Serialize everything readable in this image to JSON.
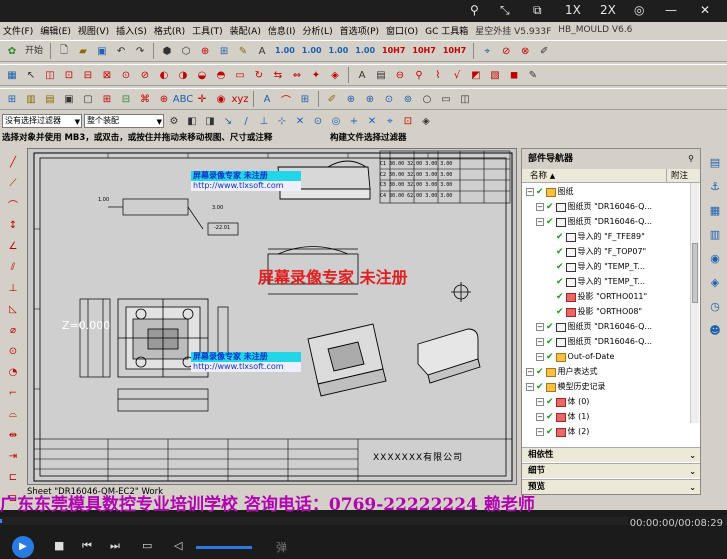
{
  "player": {
    "top_icons": [
      "pin-icon",
      "shrink-icon",
      "popout-icon"
    ],
    "speed_1x": "1X",
    "speed_2x": "2X",
    "time": "00:00:00/00:08:29",
    "danmu": "弹"
  },
  "menu": {
    "items": [
      "文件(F)",
      "编辑(E)",
      "视图(V)",
      "插入(S)",
      "格式(R)",
      "工具(T)",
      "装配(A)",
      "信息(I)",
      "分析(L)",
      "首选项(P)",
      "窗口(O)",
      "GC 工具箱",
      "星空外挂 V5.933F",
      "HB_MOULD V6.6"
    ]
  },
  "toolbar": {
    "start_label": "开始",
    "row1_text": [
      "1.00",
      "1.00",
      "1.00",
      "1.00",
      "10H7",
      "10H7",
      "10H7"
    ],
    "selection_filter": "没有选择过滤器",
    "assembly_scope": "整个装配"
  },
  "status": {
    "prompt": "选择对象并使用 MB3，或双击，或按住并拖动来移动视图、尺寸或注释",
    "secondary": "构建文件选择过滤器"
  },
  "drawing": {
    "watermark_top": "屏幕录像专家     未注册",
    "watermark_url": "http://www.tlxsoft.com",
    "watermark_big": "屏幕录像专家  未注册",
    "z_label": "Z=0.000",
    "company": "XXXXXXX有限公司",
    "sheet_label": "Sheet \"DR16046-QM-EC2\" Work",
    "table_rows": [
      [
        "C1",
        "30.00",
        "32.00",
        "3.00",
        "3.00"
      ],
      [
        "C2",
        "30.00",
        "32.00",
        "3.00",
        "3.00"
      ],
      [
        "C3",
        "30.00",
        "32.00",
        "3.00",
        "3.00"
      ],
      [
        "C4",
        "30.00",
        "62.00",
        "3.00",
        "3.00"
      ]
    ]
  },
  "navigator": {
    "title": "部件导航器",
    "col_name": "名称",
    "col_note": "附注",
    "items": [
      {
        "label": "图纸",
        "indent": 0,
        "icon": "folder"
      },
      {
        "label": "图纸页 \"DR16046-Q...",
        "indent": 1,
        "icon": "sheet"
      },
      {
        "label": "图纸页 \"DR16046-Q...",
        "indent": 1,
        "icon": "sheet"
      },
      {
        "label": "导入的 \"F_TFE89\"",
        "indent": 2,
        "icon": "view"
      },
      {
        "label": "导入的 \"F_TOP07\"",
        "indent": 2,
        "icon": "view"
      },
      {
        "label": "导入的 \"TEMP_T...",
        "indent": 2,
        "icon": "view"
      },
      {
        "label": "导入的 \"TEMP_T...",
        "indent": 2,
        "icon": "view"
      },
      {
        "label": "投影 \"ORTHO011\"",
        "indent": 2,
        "icon": "proj"
      },
      {
        "label": "投影 \"ORTHO08\"",
        "indent": 2,
        "icon": "proj"
      },
      {
        "label": "图纸页 \"DR16046-Q...",
        "indent": 1,
        "icon": "sheet"
      },
      {
        "label": "图纸页 \"DR16046-Q...",
        "indent": 1,
        "icon": "sheet"
      },
      {
        "label": "Out-of-Date",
        "indent": 1,
        "icon": "warn"
      },
      {
        "label": "用户表达式",
        "indent": 0,
        "icon": "folder"
      },
      {
        "label": "模型历史记录",
        "indent": 0,
        "icon": "folder"
      },
      {
        "label": "体 (0)",
        "indent": 1,
        "icon": "body"
      },
      {
        "label": "体 (1)",
        "indent": 1,
        "icon": "body"
      },
      {
        "label": "体 (2)",
        "indent": 1,
        "icon": "body"
      }
    ],
    "sections": [
      "相依性",
      "细节",
      "预览"
    ]
  },
  "marquee": "广东东莞模具数控专业培训学校 咨询电话：0769-22222224 赖老师"
}
